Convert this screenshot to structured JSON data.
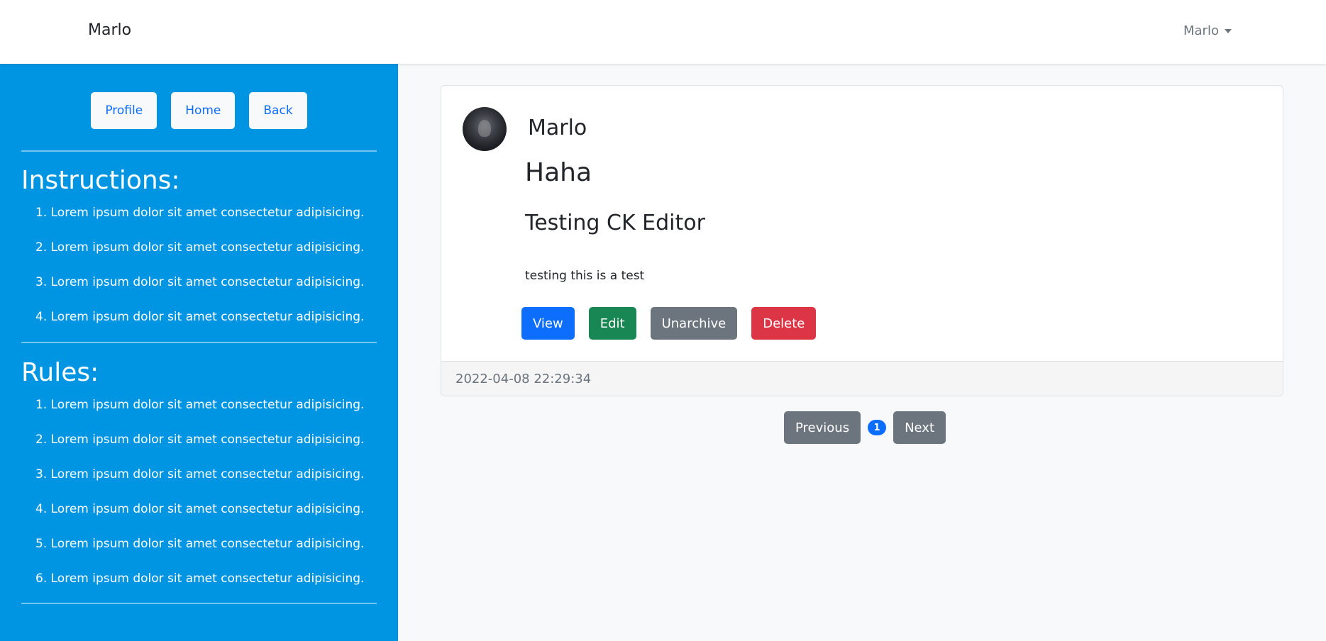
{
  "navbar": {
    "brand": "Marlo",
    "user_menu": "Marlo"
  },
  "sidebar": {
    "buttons": {
      "profile": "Profile",
      "home": "Home",
      "back": "Back"
    },
    "instructions": {
      "heading": "Instructions:",
      "items": [
        "Lorem ipsum dolor sit amet consectetur adipisicing.",
        "Lorem ipsum dolor sit amet consectetur adipisicing.",
        "Lorem ipsum dolor sit amet consectetur adipisicing.",
        "Lorem ipsum dolor sit amet consectetur adipisicing."
      ]
    },
    "rules": {
      "heading": "Rules:",
      "items": [
        "Lorem ipsum dolor sit amet consectetur adipisicing.",
        "Lorem ipsum dolor sit amet consectetur adipisicing.",
        "Lorem ipsum dolor sit amet consectetur adipisicing.",
        "Lorem ipsum dolor sit amet consectetur adipisicing.",
        "Lorem ipsum dolor sit amet consectetur adipisicing.",
        "Lorem ipsum dolor sit amet consectetur adipisicing."
      ]
    }
  },
  "post": {
    "author": "Marlo",
    "title": "Haha",
    "subtitle": "Testing CK Editor",
    "body": "testing this is a test",
    "actions": {
      "view": "View",
      "edit": "Edit",
      "unarchive": "Unarchive",
      "delete": "Delete"
    },
    "timestamp": "2022-04-08 22:29:34"
  },
  "pagination": {
    "previous": "Previous",
    "current_page": "1",
    "next": "Next"
  },
  "colors": {
    "sidebar_bg": "#0095e3",
    "primary": "#0d6efd",
    "success": "#198754",
    "secondary": "#6c757d",
    "danger": "#dc3545"
  }
}
